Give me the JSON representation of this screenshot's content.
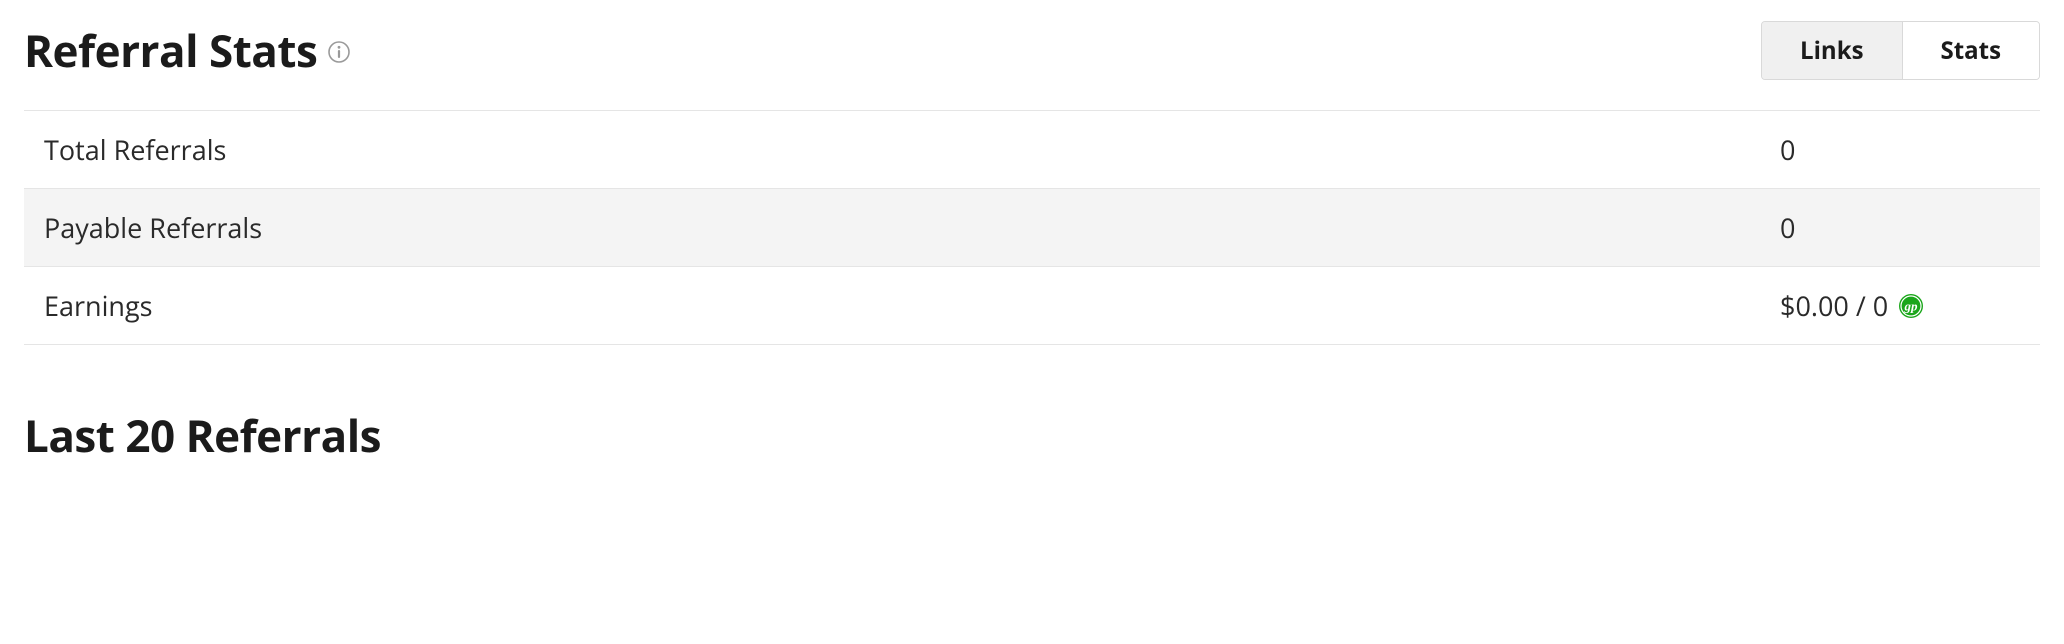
{
  "header": {
    "title": "Referral Stats"
  },
  "tabs": {
    "links": "Links",
    "stats": "Stats"
  },
  "stats": {
    "rows": [
      {
        "label": "Total Referrals",
        "value": "0"
      },
      {
        "label": "Payable Referrals",
        "value": "0"
      },
      {
        "label": "Earnings",
        "value": "$0.00 / 0"
      }
    ]
  },
  "section2": {
    "title": "Last 20 Referrals"
  },
  "colors": {
    "currency_icon": "#1aa61a"
  }
}
